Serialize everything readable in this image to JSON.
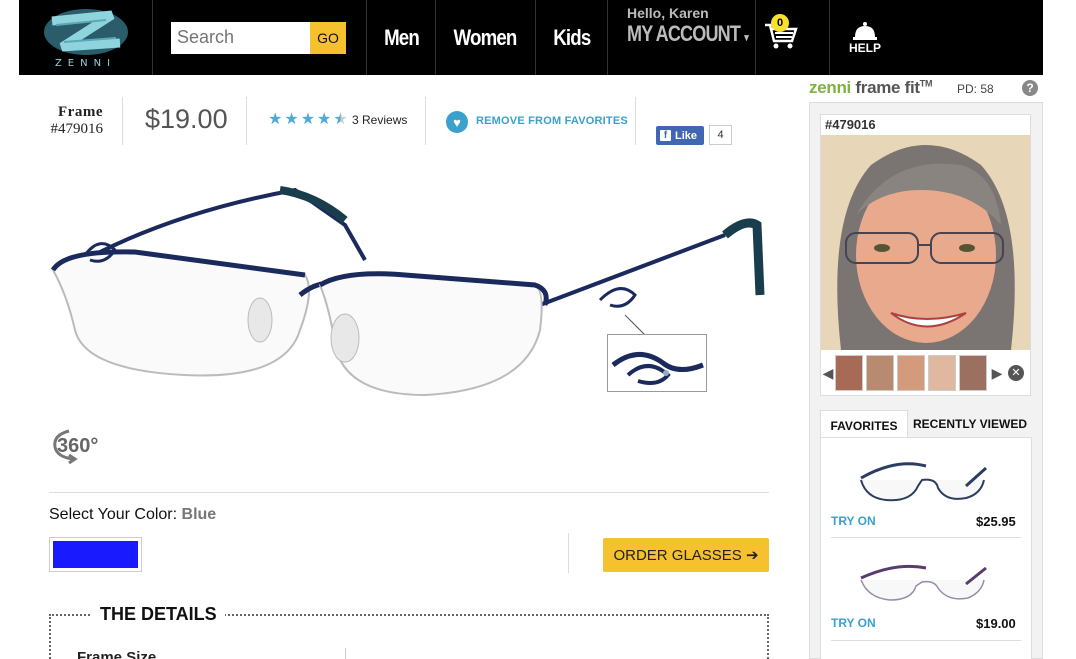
{
  "header": {
    "logo_text": "ZENNI",
    "search_placeholder": "Search",
    "search_button": "GO",
    "nav": {
      "men": "Men",
      "women": "Women",
      "kids": "Kids"
    },
    "greeting": "Hello, Karen",
    "account_label": "MY ACCOUNT",
    "cart_count": "0",
    "help_label": "HELP"
  },
  "product": {
    "frame_label": "Frame",
    "frame_id": "#479016",
    "price": "$19.00",
    "rating": 4.5,
    "reviews": "3 Reviews",
    "favorite_action": "REMOVE FROM FAVORITES",
    "fb_like": "Like",
    "fb_count": "4",
    "rotate_label": "360°",
    "color_label": "Select Your Color:",
    "color_value": "Blue",
    "color_hex": "#1a1aff",
    "order_button": "ORDER GLASSES ➔",
    "details_title": "THE DETAILS",
    "frame_size_label": "Frame Size"
  },
  "frame_fit": {
    "brand_green": "zenni",
    "brand_dark": "frame fit",
    "trademark": "TM",
    "pd": "PD: 58",
    "help": "?",
    "sku": "#479016",
    "tabs": {
      "favorites": "FAVORITES",
      "recent": "RECENTLY VIEWED"
    },
    "items": [
      {
        "try_on": "TRY ON",
        "price": "$25.95"
      },
      {
        "try_on": "TRY ON",
        "price": "$19.00"
      }
    ]
  },
  "colors": {
    "accent_yellow": "#f5c12e",
    "link_blue": "#3aa0cc",
    "frame_green": "#7cb342"
  }
}
